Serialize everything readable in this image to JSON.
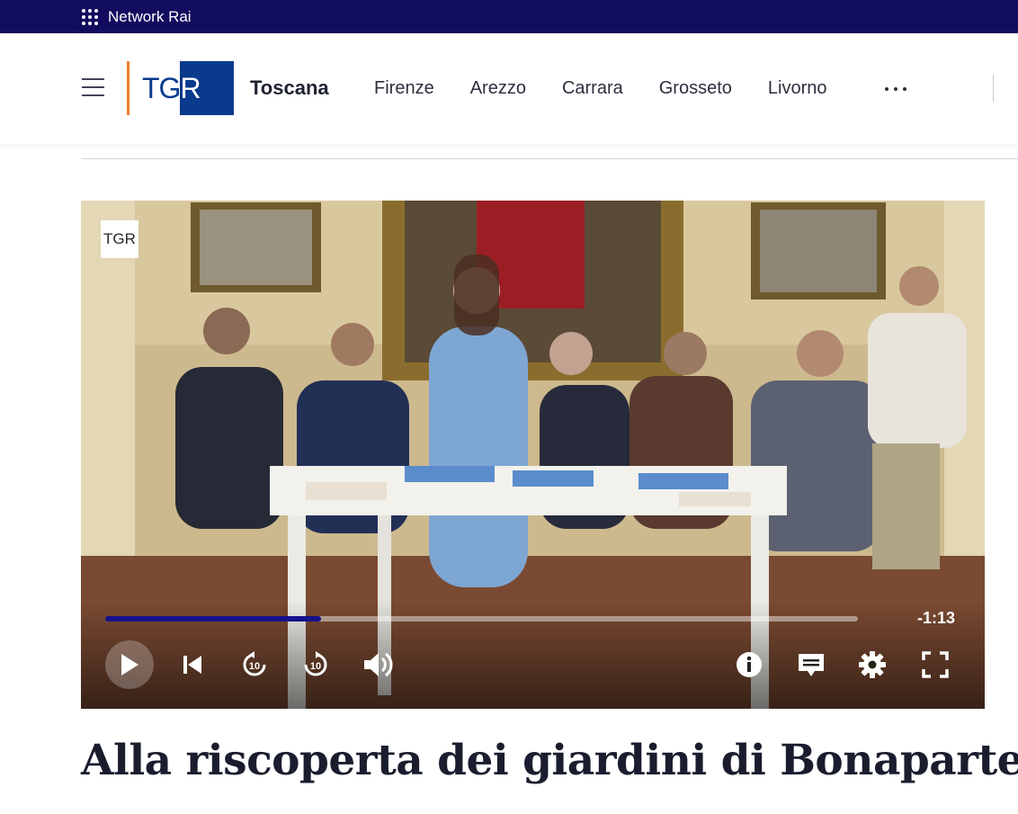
{
  "network_bar": {
    "label": "Network Rai",
    "icon": "grid-dots-icon"
  },
  "header": {
    "logo_text": "TGR",
    "region": "Toscana",
    "nav": [
      "Firenze",
      "Arezzo",
      "Carrara",
      "Grosseto",
      "Livorno"
    ],
    "more_icon": "more-dots-icon"
  },
  "player": {
    "watermark": "TGR",
    "remaining_time": "-1:13",
    "progress": 0.287,
    "controls": [
      "play-icon",
      "skip-back-icon",
      "rewind-10-icon",
      "forward-10-icon",
      "volume-icon",
      "info-icon",
      "subtitles-icon",
      "settings-icon",
      "fullscreen-icon"
    ]
  },
  "article": {
    "title": "Alla riscoperta dei giardini di Bonaparte"
  },
  "colors": {
    "network_bar": "#120c5e",
    "brand_blue": "#0a3a8c",
    "brand_orange": "#f07c2a",
    "progress": "#14128a"
  }
}
